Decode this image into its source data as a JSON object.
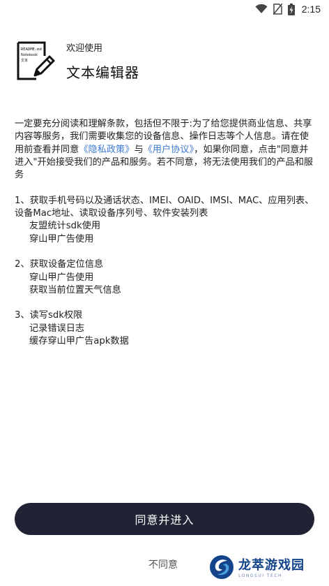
{
  "status_bar": {
    "time": "2:15",
    "icons": [
      "wifi-icon",
      "no-sim-icon",
      "battery-charging-icon"
    ]
  },
  "header": {
    "welcome": "欢迎使用",
    "app_name": "文本编辑器",
    "logo_icon": "notepad-pencil-icon",
    "logo_text_1": "README.md",
    "logo_text_2": "Notebook",
    "logo_text_3": "文本"
  },
  "agreement": {
    "intro_part1": "一定要充分阅读和理解条款，包括但不限于:为了给您提供商业信息、共享内容等服务，我们需要收集您的设备信息、操作日志等个人信息。请在使用前查看并同意",
    "privacy_link": "《隐私政策》",
    "intro_and": "与",
    "user_link": "《用户协议》",
    "intro_part2": "，如果你同意，点击\"同意并进入\"开始接受我们的产品和服务。若不同意，将无法使用我们的产品和服务",
    "sections": [
      {
        "title": "1、获取手机号码以及通话状态、IMEI、OAID、IMSI、MAC、应用列表、设备Mac地址、读取设备序列号、软件安装列表",
        "items": [
          "友盟统计sdk使用",
          "穿山甲广告使用"
        ]
      },
      {
        "title": "2、获取设备定位信息",
        "items": [
          "穿山甲广告使用",
          "获取当前位置天气信息"
        ]
      },
      {
        "title": "3、读写sdk权限",
        "items": [
          "记录错误日志",
          "缓存穿山甲广告apk数据"
        ]
      }
    ]
  },
  "buttons": {
    "agree": "同意并进入",
    "disagree": "不同意"
  },
  "watermark": {
    "main": "龙萃游戏园",
    "sub": "LONGSUI TECH"
  },
  "colors": {
    "button_bg": "#1f2333",
    "link": "#3b7bd4",
    "watermark": "#14458b"
  }
}
